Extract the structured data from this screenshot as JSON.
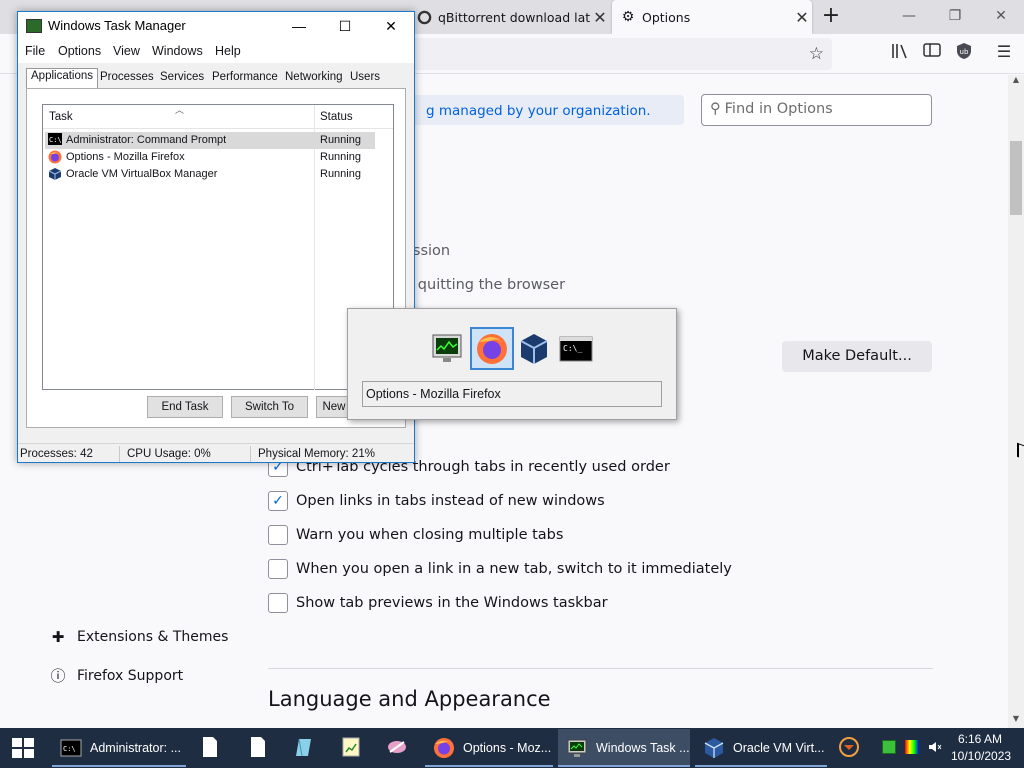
{
  "firefox": {
    "tabs": [
      {
        "label": "qBittorrent download lates"
      },
      {
        "label": "Options"
      }
    ],
    "content": {
      "policy_banner": "g managed by your organization.",
      "find_placeholder": "Find in Options",
      "session_text": "ession",
      "quit_text": "n quitting the browser",
      "make_default_label": "Make Default...",
      "checkboxes": [
        {
          "label": "Ctrl+Tab cycles through tabs in recently used order",
          "checked": true
        },
        {
          "label": "Open links in tabs instead of new windows",
          "checked": true
        },
        {
          "label": "Warn you when closing multiple tabs",
          "checked": false
        },
        {
          "label": "When you open a link in a new tab, switch to it immediately",
          "checked": false
        },
        {
          "label": "Show tab previews in the Windows taskbar",
          "checked": false
        }
      ],
      "sidebar_links": [
        {
          "label": "Extensions & Themes",
          "icon": "puzzle-icon"
        },
        {
          "label": "Firefox Support",
          "icon": "help-icon"
        }
      ],
      "section_heading": "Language and Appearance"
    }
  },
  "taskmgr": {
    "title": "Windows Task Manager",
    "menus": [
      "File",
      "Options",
      "View",
      "Windows",
      "Help"
    ],
    "tabs": [
      "Applications",
      "Processes",
      "Services",
      "Performance",
      "Networking",
      "Users"
    ],
    "columns": {
      "task": "Task",
      "status": "Status"
    },
    "rows": [
      {
        "name": "Administrator: Command Prompt",
        "status": "Running",
        "icon": "cmd-icon",
        "selected": true
      },
      {
        "name": "Options - Mozilla Firefox",
        "status": "Running",
        "icon": "firefox-icon",
        "selected": false
      },
      {
        "name": "Oracle VM VirtualBox Manager",
        "status": "Running",
        "icon": "virtualbox-icon",
        "selected": false
      }
    ],
    "buttons": {
      "end_task": "End Task",
      "switch_to": "Switch To",
      "new_task": "New"
    },
    "status": {
      "processes": "Processes: 42",
      "cpu": "CPU Usage: 0%",
      "memory": "Physical Memory: 21%"
    }
  },
  "alttab": {
    "icons": [
      "taskmgr-icon",
      "firefox-icon",
      "virtualbox-icon",
      "cmd-icon"
    ],
    "selected_index": 1,
    "label": "Options - Mozilla Firefox"
  },
  "taskbar": {
    "apps": [
      {
        "label": "Administrator: ...",
        "icon": "cmd-icon"
      },
      {
        "label": "Options - Moz...",
        "icon": "firefox-icon"
      },
      {
        "label": "Windows Task ...",
        "icon": "taskmgr-icon"
      },
      {
        "label": "Oracle VM Virt...",
        "icon": "virtualbox-icon"
      }
    ],
    "clock": {
      "time": "6:16 AM",
      "date": "10/10/2023"
    }
  },
  "colors": {
    "accent": "#0061e0",
    "taskbar_bg": "#1f2d42",
    "taskmgr_border": "#1979ca"
  }
}
